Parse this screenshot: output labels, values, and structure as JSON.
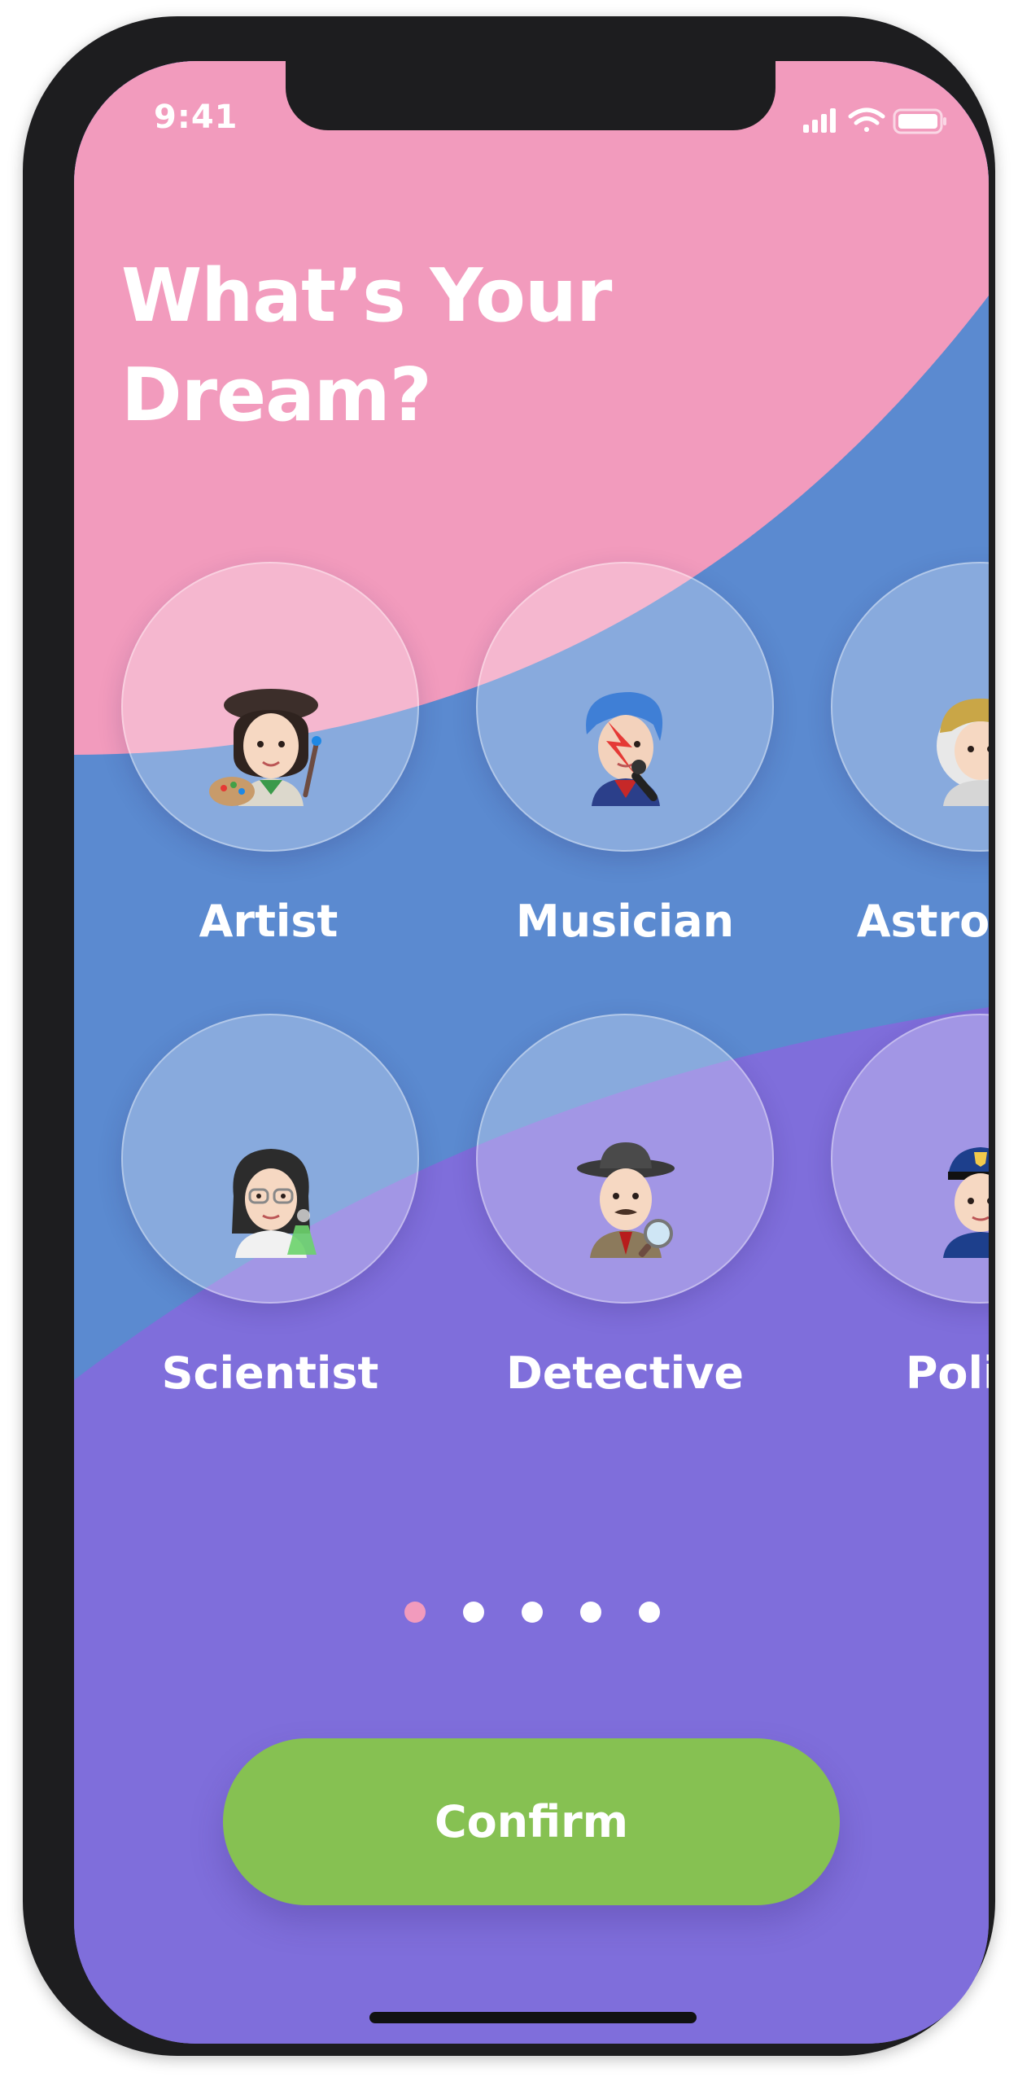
{
  "status_bar": {
    "time": "9:41"
  },
  "title_line1": "What’s Your",
  "title_line2": "Dream?",
  "professions": [
    {
      "label": "Artist",
      "icon": "artist-emoji"
    },
    {
      "label": "Musician",
      "icon": "musician-emoji"
    },
    {
      "label": "Astronaut",
      "icon": "astronaut-emoji"
    },
    {
      "label": "Scientist",
      "icon": "scientist-emoji"
    },
    {
      "label": "Detective",
      "icon": "detective-emoji"
    },
    {
      "label": "Police",
      "icon": "police-emoji"
    }
  ],
  "pagination": {
    "pages": 5,
    "current": 1
  },
  "confirm_label": "Confirm",
  "colors": {
    "pink": "#f29bbd",
    "blue": "#5b8ad0",
    "purple": "#7f6edb",
    "green": "#86c152"
  }
}
